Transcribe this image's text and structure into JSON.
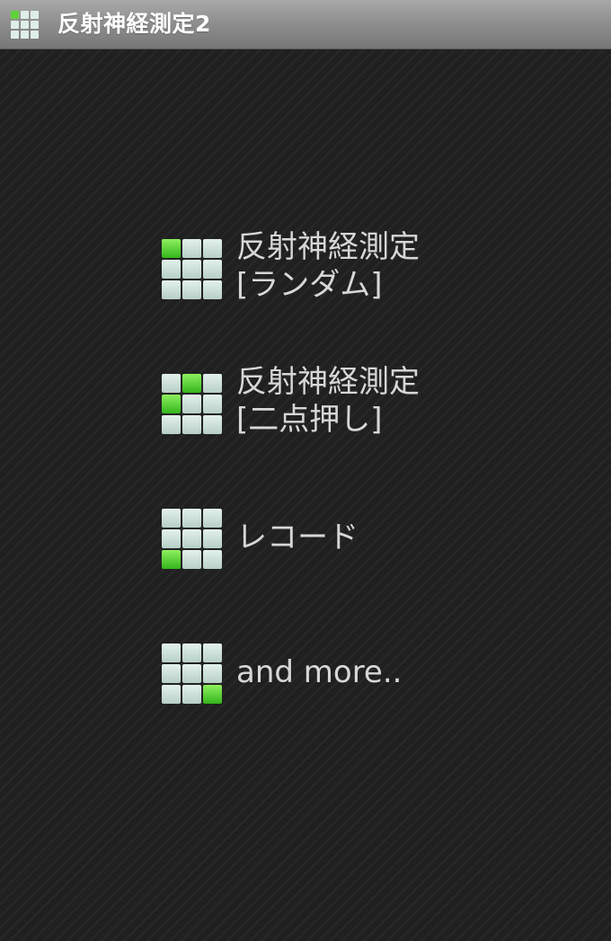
{
  "titlebar": {
    "title": "反射神経測定2",
    "icon": "grid-app-icon"
  },
  "menu": {
    "items": [
      {
        "line1": "反射神経測定",
        "line2": "[ランダム]",
        "icon": "grid-icon",
        "highlighted_cell": "top-left"
      },
      {
        "line1": "反射神経測定",
        "line2": "[二点押し]",
        "icon": "grid-icon",
        "highlighted_cells": [
          "top-middle",
          "middle-left"
        ]
      },
      {
        "line1": "レコード",
        "icon": "grid-icon",
        "highlighted_cell": "bottom-left"
      },
      {
        "line1": "and more..",
        "icon": "grid-icon",
        "highlighted_cell": "bottom-right"
      }
    ]
  },
  "colors": {
    "background": "#202020",
    "grid_tile": "#c9dfd8",
    "grid_highlight": "#5fd23a",
    "label_text": "#d7d7d7",
    "titlebar": "#8f8f8f"
  }
}
